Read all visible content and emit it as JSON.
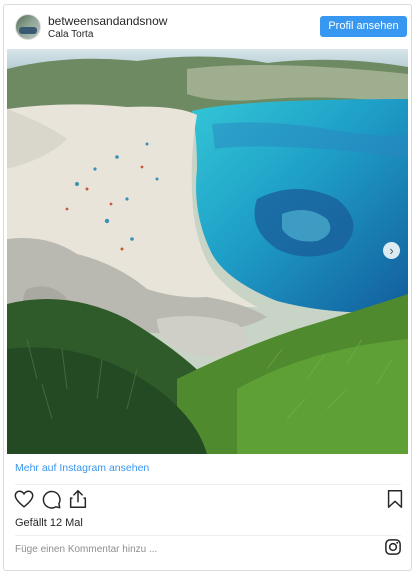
{
  "post": {
    "username": "betweensandandsnow",
    "location": "Cala Torta",
    "profile_button": "Profil ansehen",
    "more_link": "Mehr auf Instagram ansehen",
    "likes_text": "Gefällt 12 Mal",
    "comment_placeholder": "Füge einen Kommentar hinzu ..."
  },
  "icons": {
    "like": "heart-icon",
    "comment": "comment-icon",
    "share": "share-icon",
    "save": "bookmark-icon",
    "brand": "instagram-icon",
    "carousel_next": "chevron-right-icon"
  },
  "colors": {
    "accent": "#3897f0",
    "text": "#262626",
    "muted": "#8e8e8e",
    "border": "#dbdbdb"
  }
}
